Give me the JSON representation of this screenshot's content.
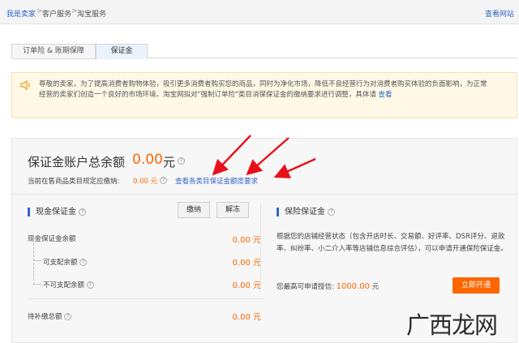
{
  "breadcrumb": {
    "items": [
      "我是卖家",
      "客户服务",
      "淘宝服务"
    ],
    "separator": ">"
  },
  "header": {
    "record_link": "查看网站"
  },
  "tabs": [
    {
      "label": "订单险 & 账期保障",
      "active": false
    },
    {
      "label": "保证金",
      "active": true
    }
  ],
  "notice": {
    "icon": "speaker-icon",
    "text": "尊敬的卖家，为了提高消费者购物体验，吸引更多消费者购买您的商品，同时为净化市场，降低不良经营行为对消费者购买体验的负面影响，为正常经营的卖家们创造一个良好的市场环境。淘宝网拟对\"强制订单险\"类目消保保证金的缴纳要求进行调整，具体请",
    "link": "查看"
  },
  "summary": {
    "total_label": "保证金账户总余额",
    "total_amount": "0.00",
    "total_unit": "元",
    "required_label": "当前在售商品类目规定应缴纳:",
    "required_amount": "0.00 元",
    "requirement_link": "查看各类目保证金额度要求"
  },
  "cash": {
    "title": "现金保证金",
    "deposit_button": "缴纳",
    "unfreeze_button": "解冻",
    "rows": [
      {
        "label": "现金保证金余额",
        "amount": "0.00 元"
      },
      {
        "label": "可支配余额",
        "amount": "0.00 元"
      },
      {
        "label": "不可支配余额",
        "amount": "0.00 元"
      },
      {
        "label": "待补缴总额",
        "amount": "0.00 元"
      }
    ]
  },
  "insurance": {
    "title": "保险保证金",
    "description": "根据您的店铺经营状态（包含开店时长、交易额、好评率、DSR评分、退款率、纠纷率、小二介入率等店铺信息综合评估），可以申请开通保险保证金。",
    "max_label": "您最高可申请授信:",
    "max_amount": "1000.00",
    "max_unit": "元",
    "open_button": "立即开通"
  },
  "watermark": "广西龙网",
  "colors": {
    "accent": "#ff6600",
    "link": "#3366cc",
    "arrow": "#e8101a",
    "notice_bg": "#fff8e6"
  }
}
